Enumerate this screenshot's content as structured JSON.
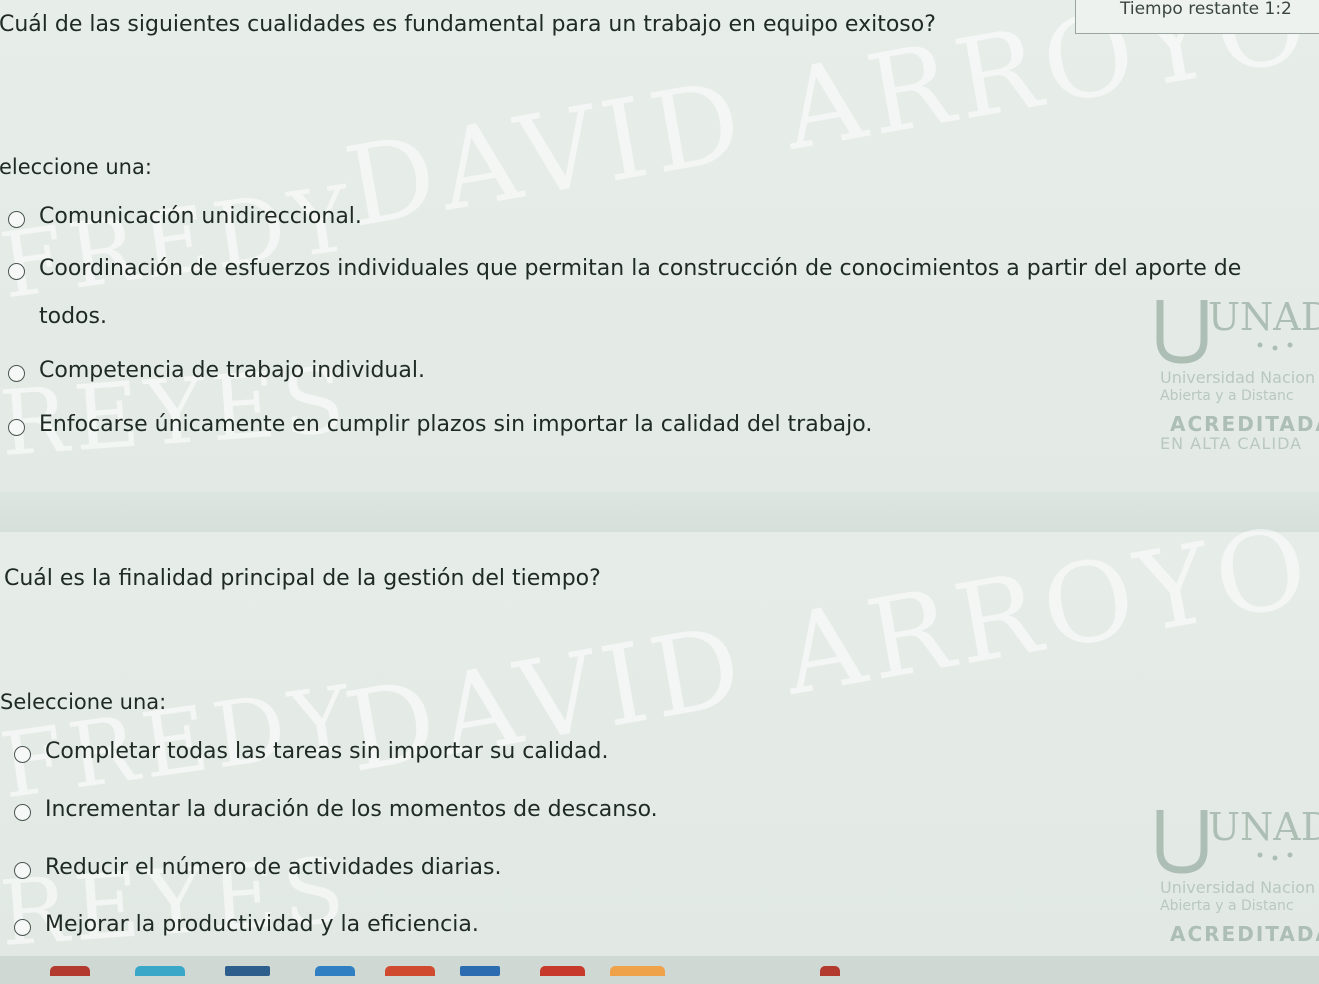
{
  "timer": {
    "label": "Tiempo restante 1:2"
  },
  "question1": {
    "text": "Cuál de las siguientes cualidades es fundamental para un trabajo en equipo exitoso?",
    "prompt": "eleccione una:",
    "options": [
      "Comunicación unidireccional.",
      "Coordinación de esfuerzos individuales que permitan la construcción de conocimientos a partir del aporte de todos.",
      "Competencia de trabajo individual.",
      "Enfocarse únicamente en cumplir plazos sin importar la calidad del trabajo."
    ]
  },
  "question2": {
    "text": "Cuál es la finalidad principal de la gestión del tiempo?",
    "prompt": "Seleccione una:",
    "options": [
      "Completar todas las tareas sin importar su calidad.",
      "Incrementar la duración de los momentos de descanso.",
      "Reducir el número de actividades diarias.",
      "Mejorar la productividad y la eficiencia."
    ]
  },
  "watermark": {
    "line1": "DAVID ARROYO",
    "line2": "FREDY",
    "line3": "REYES"
  },
  "logo": {
    "letters": "UNAD",
    "line1": "Universidad Nacion",
    "line2": "Abierta y a Distanc",
    "line3": "ACREDITADA",
    "line4": "EN ALTA CALIDA"
  },
  "colors": {
    "background": "#e4eae6",
    "separator": "#d6e0db",
    "text": "#1f2a24"
  }
}
